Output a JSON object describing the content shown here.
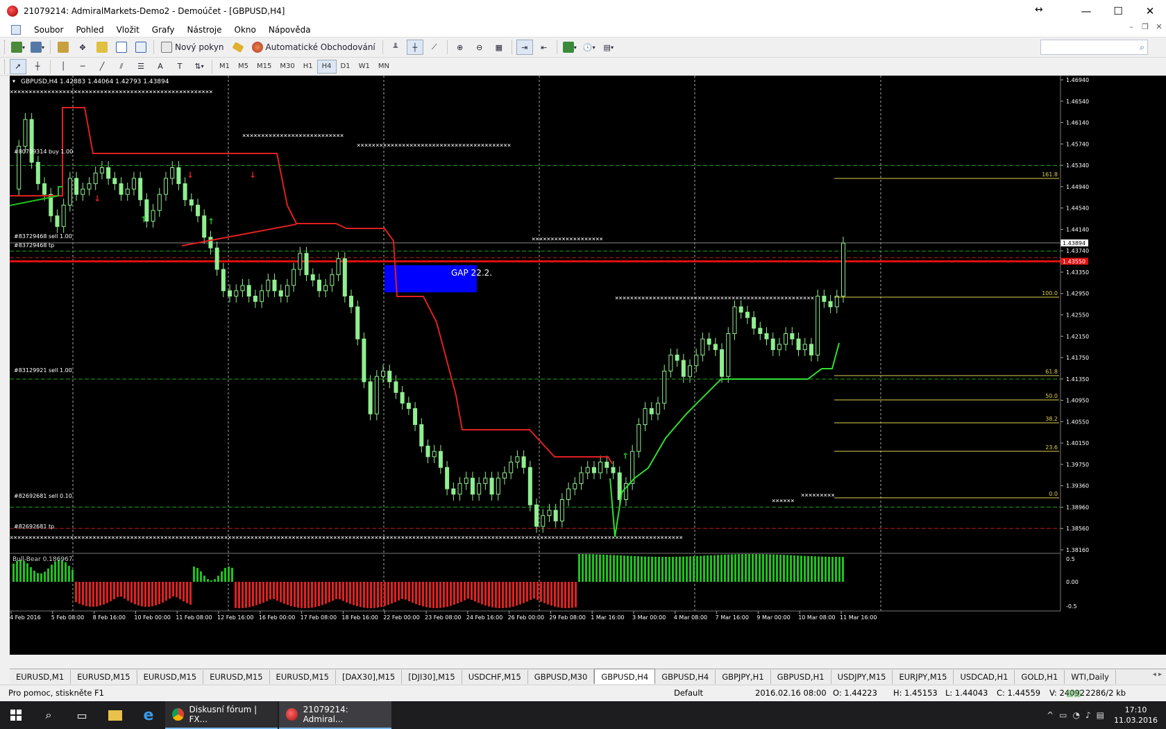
{
  "window": {
    "title": "21079214: AdmiralMarkets-Demo2 - Demoúčet - [GBPUSD,H4]"
  },
  "menu": {
    "items": [
      "Soubor",
      "Pohled",
      "Vložit",
      "Grafy",
      "Nástroje",
      "Okno",
      "Nápověda"
    ]
  },
  "toolbar": {
    "new_order_label": "Nový pokyn",
    "autotrading_label": "Automatické Obchodování"
  },
  "timeframes": {
    "items": [
      "M1",
      "M5",
      "M15",
      "M30",
      "H1",
      "H4",
      "D1",
      "W1",
      "MN"
    ],
    "active": "H4"
  },
  "chart": {
    "header": "GBPUSD,H4  1.42883 1.44064 1.42793 1.43894",
    "gap_label": "GAP 22.2.",
    "order_labels": [
      "#80709314 buy 1.00",
      "#83729468 sell 1.00",
      "#83729468 tp",
      "#83129921 sell 1.00",
      "#82692681 sell 0.10",
      "#82692681 tp"
    ],
    "price_axis": [
      "1.46940",
      "1.46540",
      "1.46140",
      "1.45740",
      "1.45340",
      "1.44940",
      "1.44540",
      "1.44140",
      "1.43740",
      "1.43350",
      "1.42950",
      "1.42550",
      "1.42150",
      "1.41750",
      "1.41350",
      "1.40950",
      "1.40550",
      "1.40150",
      "1.39750",
      "1.39360",
      "1.38960",
      "1.38560",
      "1.38160"
    ],
    "current_price": "1.43894",
    "red_line_price": "1.43550",
    "fib_labels": [
      "161.8",
      "100.0",
      "61.8",
      "50.0",
      "38.2",
      "23.6",
      "0.0"
    ],
    "indicator_label": "Bull-Bear 0.186967",
    "indicator_axis": [
      "0.5",
      "0.00",
      "-0.5"
    ],
    "time_axis": [
      "4 Feb 2016",
      "5 Feb 08:00",
      "8 Feb 16:00",
      "10 Feb 00:00",
      "11 Feb 08:00",
      "12 Feb 16:00",
      "16 Feb 00:00",
      "17 Feb 08:00",
      "18 Feb 16:00",
      "22 Feb 00:00",
      "23 Feb 08:00",
      "24 Feb 16:00",
      "26 Feb 00:00",
      "29 Feb 08:00",
      "1 Mar 16:00",
      "3 Mar 00:00",
      "4 Mar 08:00",
      "7 Mar 16:00",
      "9 Mar 00:00",
      "10 Mar 08:00",
      "11 Mar 16:00"
    ]
  },
  "tabs": {
    "items": [
      "EURUSD,M1",
      "EURUSD,M15",
      "EURUSD,M15",
      "EURUSD,M15",
      "EURUSD,M15",
      "[DAX30],M15",
      "[DJI30],M15",
      "USDCHF,M15",
      "GBPUSD,M30",
      "GBPUSD,H4",
      "GBPUSD,H4",
      "GBPJPY,H1",
      "GBPUSD,H1",
      "USDJPY,M15",
      "EURJPY,M15",
      "USDCAD,H1",
      "GOLD,H1",
      "WTI,Daily"
    ],
    "active_index": 9
  },
  "status": {
    "help": "Pro pomoc, stiskněte F1",
    "profile": "Default",
    "datetime": "2016.02.16 08:00",
    "open": "O: 1.44223",
    "high": "H: 1.45153",
    "low": "L: 1.44043",
    "close": "C: 1.44559",
    "volume": "V: 24092",
    "traffic": "2286/2 kb"
  },
  "taskbar": {
    "apps": [
      {
        "label": "Diskusní fórum | FX...",
        "color": "#e8453c"
      },
      {
        "label": "21079214: Admiral...",
        "color": "#d93030"
      }
    ],
    "time": "17:10",
    "date": "11.03.2016"
  },
  "colors": {
    "bull": "#90ee90",
    "bear": "#e02020",
    "chart_bg": "#000000",
    "gap": "#0000ff",
    "fib": "#e0d050"
  }
}
